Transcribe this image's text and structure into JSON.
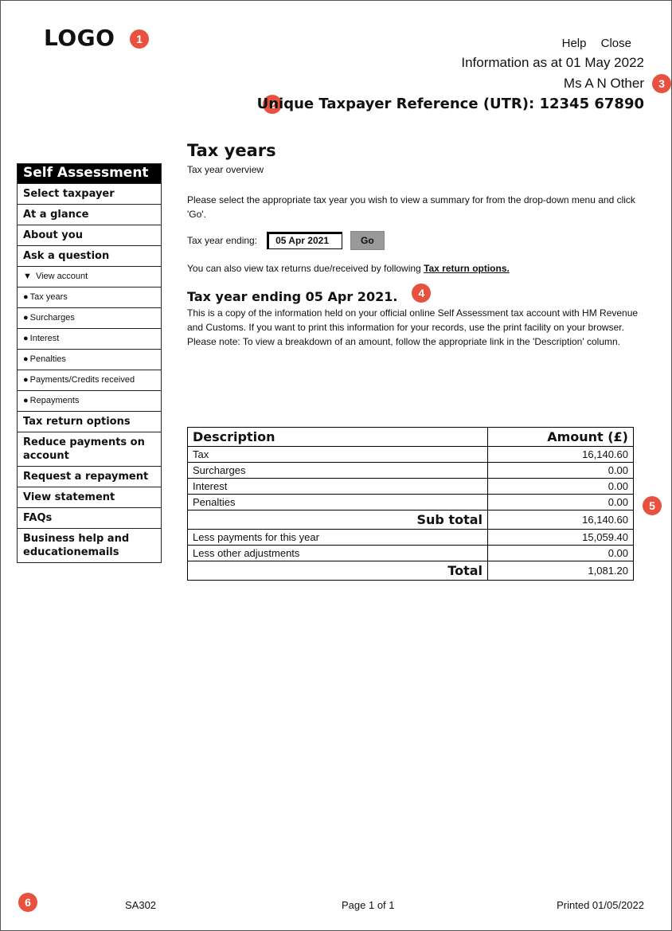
{
  "logo": "LOGO",
  "markers": [
    "1",
    "2",
    "3",
    "4",
    "5",
    "6"
  ],
  "top_links": {
    "help": "Help",
    "close": "Close"
  },
  "info_date": "Information as at 01 May 2022",
  "person_name": "Ms A N Other",
  "utr": "Unique Taxpayer Reference (UTR): 12345 67890",
  "sidebar": {
    "header": "Self Assessment",
    "items": [
      {
        "label": "Select taxpayer",
        "type": "main"
      },
      {
        "label": "At a glance",
        "type": "main"
      },
      {
        "label": "About you",
        "type": "main"
      },
      {
        "label": "Ask a question",
        "type": "main"
      },
      {
        "label": "View account",
        "type": "expand"
      },
      {
        "label": "Tax years",
        "type": "sub"
      },
      {
        "label": "Surcharges",
        "type": "sub"
      },
      {
        "label": "Interest",
        "type": "sub"
      },
      {
        "label": "Penalties",
        "type": "sub"
      },
      {
        "label": "Payments/Credits received",
        "type": "sub"
      },
      {
        "label": "Repayments",
        "type": "sub"
      },
      {
        "label": "Tax return options",
        "type": "main"
      },
      {
        "label": "Reduce payments on account",
        "type": "main"
      },
      {
        "label": "Request a repayment",
        "type": "main"
      },
      {
        "label": "View statement",
        "type": "main"
      },
      {
        "label": "FAQs",
        "type": "main"
      },
      {
        "label": "Business help and educationemails",
        "type": "main"
      }
    ]
  },
  "main": {
    "title": "Tax years",
    "subtitle": "Tax year overview",
    "instructions": "Please select the appropriate tax year you wish to view a summary for from the drop-down menu and click 'Go'.",
    "tax_year_label": "Tax year ending:",
    "selected_year": "05 Apr 2021",
    "go_label": "Go",
    "returns_text": "You can also view tax returns due/received by following ",
    "returns_link": "Tax return options.",
    "section_title": "Tax year ending 05 Apr 2021.",
    "copy_text": "This is a copy of the information held on your official online Self Assessment tax account with HM Revenue and Customs. If you want to print this information for your records, use the print facility on your browser.",
    "note_text": "Please note: To view a breakdown of an amount, follow the appropriate link in the 'Description' column."
  },
  "table": {
    "headers": {
      "description": "Description",
      "amount": "Amount (£)"
    },
    "rows": [
      {
        "description": "Tax",
        "amount": "16,140.60"
      },
      {
        "description": "Surcharges",
        "amount": "0.00"
      },
      {
        "description": "Interest",
        "amount": "0.00"
      },
      {
        "description": "Penalties",
        "amount": "0.00"
      },
      {
        "description": "Sub total",
        "amount": "16,140.60"
      },
      {
        "description": "Less payments for this year",
        "amount": "15,059.40"
      },
      {
        "description": "Less other adjustments",
        "amount": "0.00"
      },
      {
        "description": "Total",
        "amount": "1,081.20"
      }
    ]
  },
  "footer": {
    "form_code": "SA302",
    "page": "Page 1 of 1",
    "printed": "Printed 01/05/2022"
  },
  "colors": {
    "marker": "#e8513e",
    "sidebar_header_bg": "#000000",
    "go_button_bg": "#999999"
  }
}
